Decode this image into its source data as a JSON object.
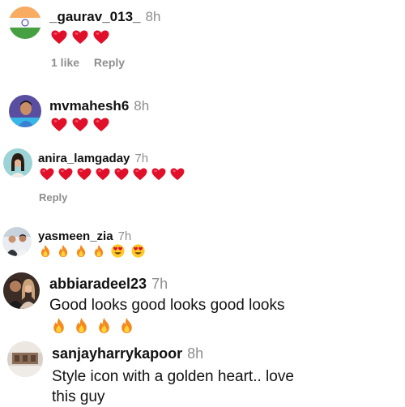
{
  "comments": [
    {
      "username": "_gaurav_013_",
      "time": "8h",
      "text": "",
      "emojis": [
        "heart",
        "heart",
        "heart"
      ],
      "likes": "1 like",
      "reply": "Reply"
    },
    {
      "username": "mvmahesh6",
      "time": "8h",
      "text": "",
      "emojis": [
        "heart",
        "heart",
        "heart"
      ]
    },
    {
      "username": "anira_lamgaday",
      "time": "7h",
      "text": "",
      "emojis": [
        "heart",
        "heart",
        "heart",
        "heart",
        "heart",
        "heart",
        "heart",
        "heart"
      ],
      "reply": "Reply"
    },
    {
      "username": "yasmeen_zia",
      "time": "7h",
      "text": "",
      "emojis": [
        "fire",
        "fire",
        "fire",
        "fire",
        "heart-eyes",
        "heart-eyes"
      ]
    },
    {
      "username": "abbiaradeel23",
      "time": "7h",
      "text": "Good looks good looks good looks",
      "emojis": [
        "fire",
        "fire",
        "fire",
        "fire"
      ]
    },
    {
      "username": "sanjayharrykapoor",
      "time": "8h",
      "text": "Style icon with a golden heart.. love this guy",
      "emojis": []
    }
  ],
  "colors": {
    "heart": "#e0102a",
    "fire_outer": "#f58a1f",
    "fire_inner": "#ffd43b",
    "muted": "#8e8e8e"
  }
}
